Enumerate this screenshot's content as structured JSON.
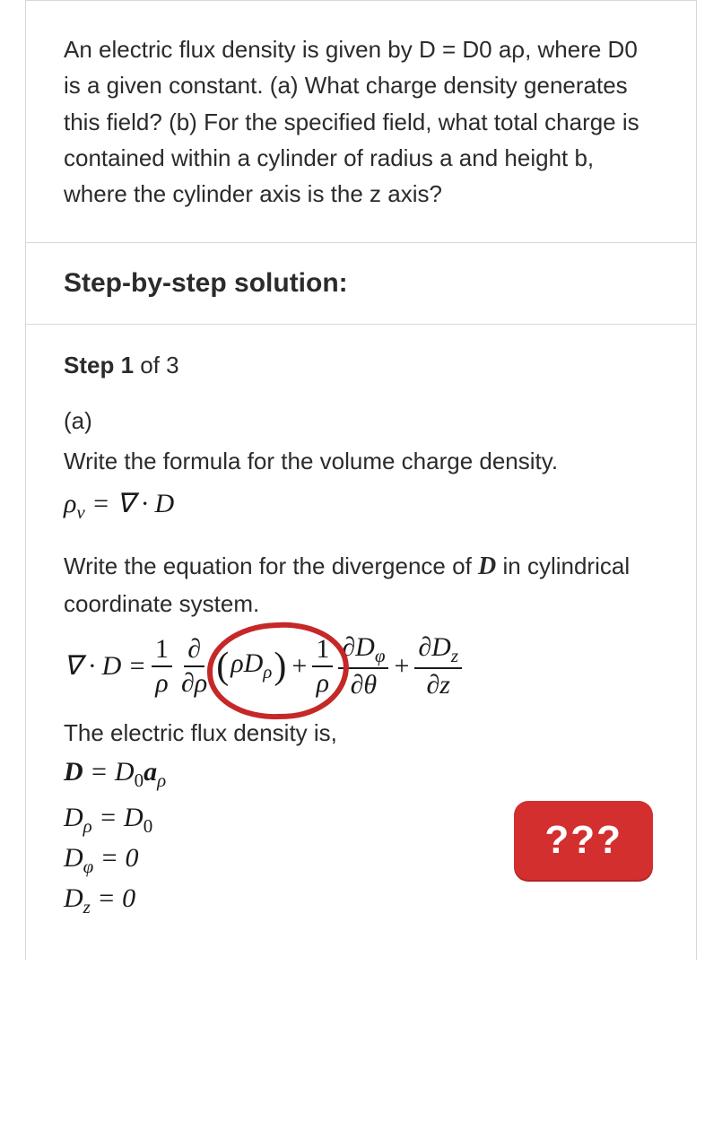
{
  "question": "An electric flux density is given by D = D0 aρ, where D0 is a given constant. (a) What charge density generates this field? (b) For the specified field, what total charge is contained within a cylinder of radius a and height b, where the cylinder axis is the z axis?",
  "solution_header": "Step-by-step solution:",
  "step": {
    "label_bold": "Step 1",
    "label_rest": " of 3",
    "part_a": "(a)",
    "intro_line1": "Write the formula for the volume charge density.",
    "eq1_lhs": "ρ",
    "eq1_sub": "v",
    "eq1_rhs": " = ∇ · D",
    "intro_line2a": "Write the equation for the divergence of ",
    "intro_line2_D": "D",
    "intro_line2b": " in cylindrical coordinate system.",
    "div_lhs": "∇ · D =",
    "frac1_num": "1",
    "frac1_den_a": "ρ",
    "frac2_num": "∂",
    "frac2_den": "∂ρ",
    "paren_inner_a": "ρD",
    "paren_inner_sub": "ρ",
    "plus1": "+",
    "frac3_num": "1",
    "frac3_den": "ρ",
    "frac4_num_a": "∂D",
    "frac4_num_sub": "φ",
    "frac4_den": "∂θ",
    "plus2": "+",
    "frac5_num_a": "∂D",
    "frac5_num_sub": "z",
    "frac5_den": "∂z",
    "flux_line": "The electric flux density is,",
    "eq3": "D = D₀aρ",
    "eq3_lhs": "D",
    "eq3_rhs_a": " = D",
    "eq3_sub0": "0",
    "eq3_rhs_b": "a",
    "eq3_sub_rho": "ρ",
    "eq4_lhs": "D",
    "eq4_sub": "ρ",
    "eq4_rhs": " = D",
    "eq4_rhs_sub": "0",
    "eq5_lhs": "D",
    "eq5_sub": "φ",
    "eq5_rhs": " = 0",
    "eq6_lhs": "D",
    "eq6_sub": "z",
    "eq6_rhs": " = 0",
    "badge_text": "???"
  }
}
